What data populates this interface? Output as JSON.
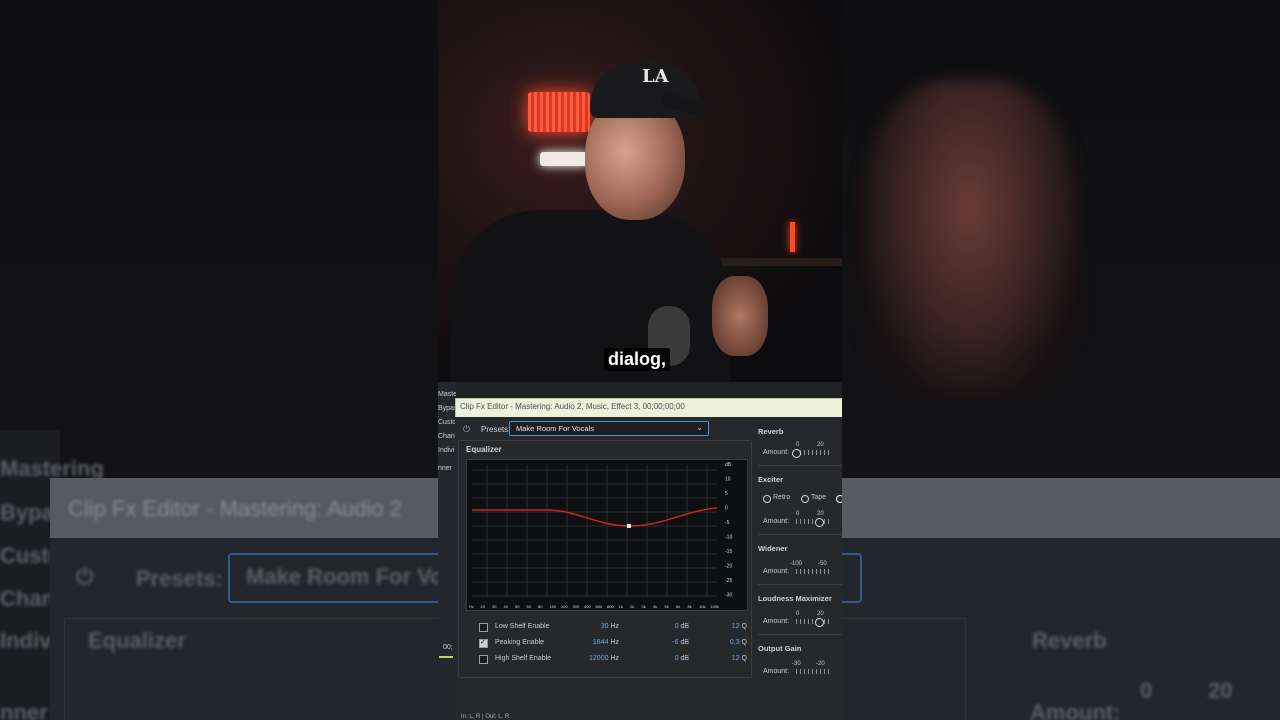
{
  "caption": "dialog,",
  "cap_logo": "LA",
  "left_panel": [
    "Mastering",
    "Bypass",
    "Custo",
    "Chan",
    "Indivi",
    "nner"
  ],
  "dialog": {
    "title": "Clip Fx Editor - Mastering: Audio 2, Music, Effect 3, 00;00;00;00",
    "presets_label": "Presets:",
    "preset_value": "Make Room For Vocals"
  },
  "equalizer": {
    "title": "Equalizer",
    "x_ticks": [
      "Hz",
      "20",
      "30",
      "40",
      "50",
      "60",
      "70",
      "80",
      "90",
      "100",
      "200",
      "300",
      "400",
      "500",
      "600",
      "800",
      "1k",
      "2k",
      "3k",
      "4k",
      "5k",
      "6k",
      "8k",
      "10k",
      "20k",
      "100k"
    ],
    "y_ticks": [
      "dB",
      "10",
      "5",
      "0",
      "-5",
      "-10",
      "-15",
      "-20",
      "-25",
      "-30"
    ],
    "bands": [
      {
        "label": "Low Shelf Enable",
        "enabled": false,
        "freq": "30",
        "freq_unit": "Hz",
        "gain": "0",
        "gain_unit": "dB",
        "q": "12",
        "q_unit": "Q"
      },
      {
        "label": "Peaking Enable",
        "enabled": true,
        "freq": "1844",
        "freq_unit": "Hz",
        "gain": "-6",
        "gain_unit": "dB",
        "q": "0,3",
        "q_unit": "Q"
      },
      {
        "label": "High Shelf Enable",
        "enabled": false,
        "freq": "12000",
        "freq_unit": "Hz",
        "gain": "0",
        "gain_unit": "dB",
        "q": "12",
        "q_unit": "Q"
      }
    ]
  },
  "right_panel": {
    "reverb": {
      "title": "Reverb",
      "amount_label": "Amount:",
      "scale": [
        "0",
        "20"
      ]
    },
    "exciter": {
      "title": "Exciter",
      "modes": [
        "Retro",
        "Tape"
      ],
      "amount_label": "Amount:",
      "scale": [
        "0",
        "20"
      ]
    },
    "widener": {
      "title": "Widener",
      "amount_label": "Amount:",
      "scale": [
        "-100",
        "-50"
      ]
    },
    "loudness": {
      "title": "Loudness Maximizer",
      "amount_label": "Amount:",
      "scale": [
        "0",
        "20"
      ]
    },
    "output_gain": {
      "title": "Output Gain",
      "amount_label": "Amount:",
      "scale": [
        "-30",
        "-20"
      ]
    }
  },
  "timecode": "00;",
  "footer": "In: L, R | Out: L, R",
  "background": {
    "title": "Clip Fx Editor - Mastering: Audio 2",
    "presets_label": "Presets:",
    "preset_value": "Make Room For Vo",
    "equalizer": "Equalizer",
    "reverb": "Reverb",
    "amount": "Amount:",
    "scale": [
      "0",
      "20"
    ],
    "left": [
      "Mastering",
      "Bypa",
      "Custo",
      "Chan",
      "Indivi",
      "nner"
    ]
  },
  "colors": {
    "accent": "#4a8fe0",
    "curve": "#c0282a",
    "panel": "#26282c"
  }
}
